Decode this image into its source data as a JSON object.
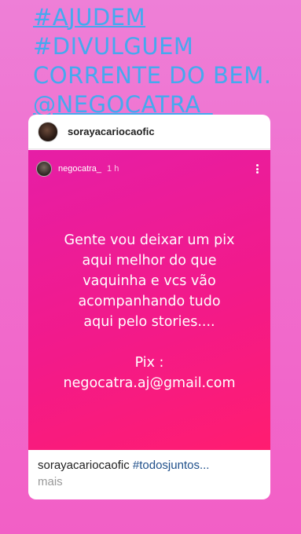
{
  "headline": {
    "line1": "#AJUDEM",
    "line2": "#DIVULGUEM",
    "line3": "CORRENTE DO BEM.",
    "line4": "@NEGOCATRA_"
  },
  "post": {
    "username": "sorayacariocaofic",
    "story": {
      "username": "negocatra_",
      "time": "1 h",
      "text_lines": [
        "Gente vou deixar um pix",
        "aqui melhor do que",
        "vaquinha e vcs vão",
        "acompanhando tudo",
        "aqui pelo stories...."
      ],
      "pix_label": "Pix :",
      "pix_email": "negocatra.aj@gmail.com"
    },
    "caption": {
      "username": "sorayacariocaofic",
      "hashtag": "#todosjuntos...",
      "more": "mais"
    }
  },
  "colors": {
    "headline": "#45a9ef",
    "background": "#f06fce",
    "story_gradient_start": "#e61ea6",
    "story_gradient_end": "#ff1c70",
    "hashtag": "#1f4f8a"
  }
}
